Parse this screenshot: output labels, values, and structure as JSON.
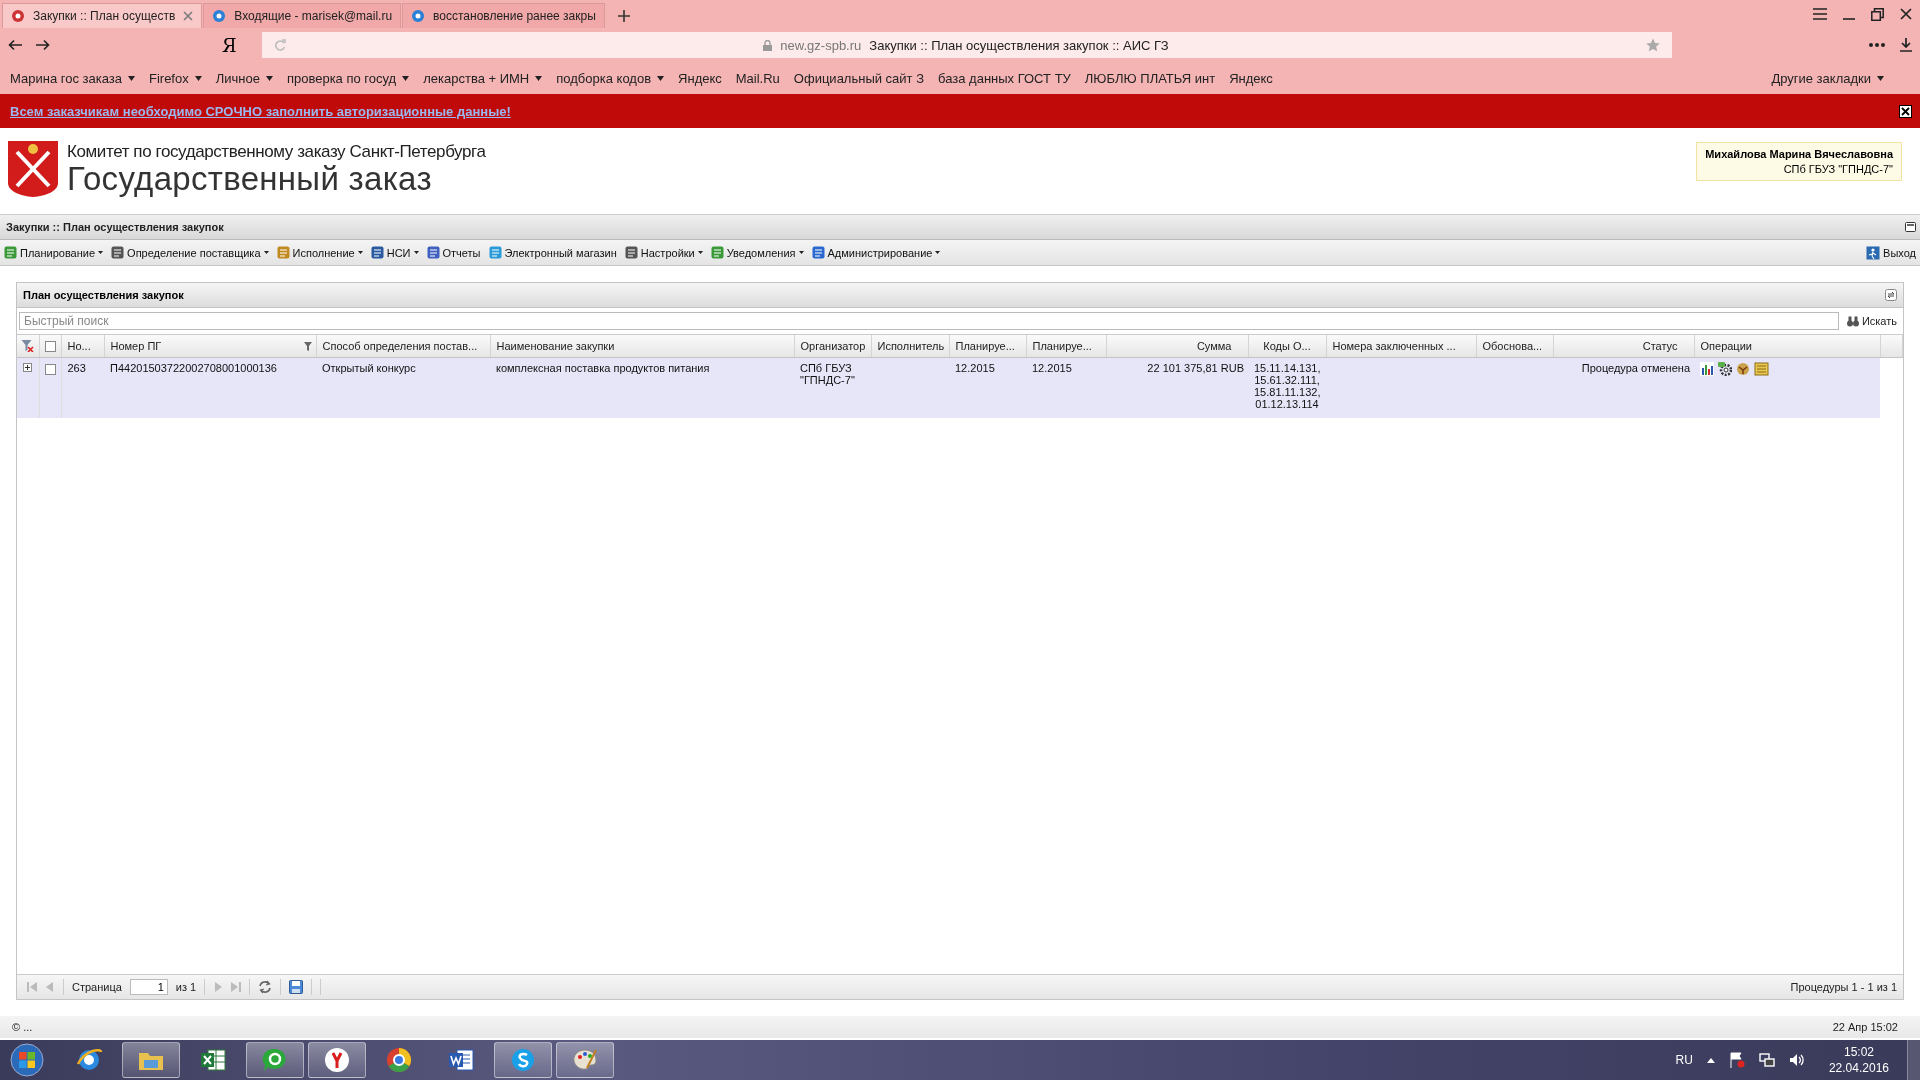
{
  "browser": {
    "tabs": [
      {
        "title": "Закупки :: План осуществ",
        "selected": true
      },
      {
        "title": "Входящие - marisek@mail.ru",
        "selected": false
      },
      {
        "title": "восстановление ранее закры",
        "selected": false
      }
    ],
    "address": {
      "logo": "Я",
      "domain": "new.gz-spb.ru",
      "page_title": "Закупки :: План осуществления закупок :: АИС ГЗ"
    },
    "bookmarks": [
      {
        "label": "Марина гос заказа",
        "dropdown": true
      },
      {
        "label": "Firefox",
        "dropdown": true
      },
      {
        "label": "Личное",
        "dropdown": true
      },
      {
        "label": "проверка по госуд",
        "dropdown": true
      },
      {
        "label": "лекарства + ИМН",
        "dropdown": true
      },
      {
        "label": "подборка кодов",
        "dropdown": true
      },
      {
        "label": "Яндекс",
        "dropdown": false
      },
      {
        "label": "Mail.Ru",
        "dropdown": false
      },
      {
        "label": "Официальный сайт З",
        "dropdown": false
      },
      {
        "label": "база данных ГОСТ ТУ",
        "dropdown": false
      },
      {
        "label": "ЛЮБЛЮ ПЛАТЬЯ инт",
        "dropdown": false
      },
      {
        "label": "Яндекс",
        "dropdown": false
      }
    ],
    "other_bookmarks": "Другие закладки"
  },
  "banner": {
    "link": "Всем заказчикам необходимо СРОЧНО заполнить авторизационные данные!"
  },
  "header": {
    "org": "Комитет по государственному заказу Санкт-Петербурга",
    "title": "Государственный заказ",
    "user": {
      "name": "Михайлова Марина Вячеславовна",
      "org": "СПб ГБУЗ \"ГПНДС-7\""
    }
  },
  "module": {
    "title": "Закупки :: План осуществления закупок"
  },
  "menu": {
    "items": [
      {
        "label": "Планирование",
        "dropdown": true
      },
      {
        "label": "Определение поставщика",
        "dropdown": true
      },
      {
        "label": "Исполнение",
        "dropdown": true
      },
      {
        "label": "НСИ",
        "dropdown": true
      },
      {
        "label": "Отчеты",
        "dropdown": false
      },
      {
        "label": "Электронный магазин",
        "dropdown": false
      },
      {
        "label": "Настройки",
        "dropdown": true
      },
      {
        "label": "Уведомления",
        "dropdown": true
      },
      {
        "label": "Администрирование",
        "dropdown": true
      }
    ],
    "exit": "Выход"
  },
  "panel": {
    "title": "План осуществления закупок",
    "search": {
      "placeholder": "Быстрый поиск",
      "button": "Искать"
    },
    "table": {
      "select_all_checked": false,
      "columns": [
        {
          "label": "Но...",
          "filtered": false
        },
        {
          "label": "Номер ПГ",
          "filtered": true
        },
        {
          "label": "Способ определения постав...",
          "filtered": false
        },
        {
          "label": "Наименование закупки",
          "filtered": false
        },
        {
          "label": "Организатор",
          "filtered": false
        },
        {
          "label": "Исполнитель",
          "filtered": false
        },
        {
          "label": "Планируе...",
          "filtered": false
        },
        {
          "label": "Планируе...",
          "filtered": false
        },
        {
          "label": "Сумма",
          "filtered": false
        },
        {
          "label": "Коды О...",
          "filtered": false
        },
        {
          "label": "Номера заключенных ...",
          "filtered": false
        },
        {
          "label": "Обоснова...",
          "filtered": false
        },
        {
          "label": "Статус",
          "filtered": false
        },
        {
          "label": "Операции",
          "filtered": false
        }
      ],
      "rows": [
        {
          "selected": true,
          "expanded": false,
          "checked": false,
          "cells": [
            "263",
            "П44201503722002708001000136",
            "Открытый конкурс",
            "комплексная поставка продуктов питания",
            "СПб ГБУЗ \"ГПНДС-7\"",
            null,
            "12.2015",
            "12.2015",
            "22 101 375,81 RUB",
            "15.11.14.131, 15.61.32.111, 15.81.11.132, 01.12.13.114",
            null,
            null,
            "Процедура отменена"
          ]
        }
      ]
    },
    "pager": {
      "page_label": "Страница",
      "page": "1",
      "of": "из 1",
      "info": "Процедуры 1 - 1 из 1"
    }
  },
  "status_bar": {
    "left": "© ...",
    "right": "22 Апр 15:02"
  },
  "taskbar": {
    "apps": [
      {
        "kind": "ie",
        "running": false
      },
      {
        "kind": "explorer",
        "running": true
      },
      {
        "kind": "excel",
        "running": false
      },
      {
        "kind": "agent",
        "running": true
      },
      {
        "kind": "yandex",
        "running": true
      },
      {
        "kind": "chrome",
        "running": false
      },
      {
        "kind": "word",
        "running": false
      },
      {
        "kind": "skype",
        "running": true
      },
      {
        "kind": "paint",
        "running": true
      }
    ],
    "tray": {
      "language": "RU",
      "time": "15:02",
      "date": "22.04.2016"
    }
  }
}
